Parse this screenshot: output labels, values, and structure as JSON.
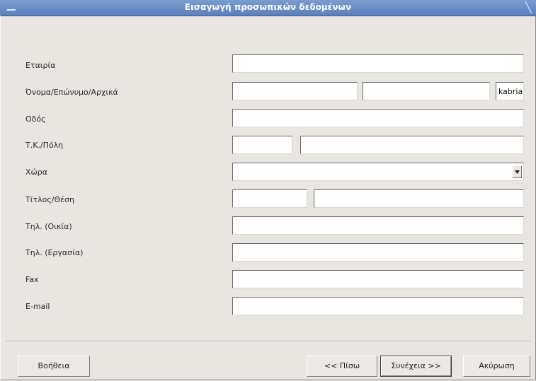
{
  "window": {
    "title": "Εισαγωγή προσωπικών δεδομένων"
  },
  "form": {
    "company_label": "Εταιρία",
    "name_label": "Όνομα/Επώνυμο/Αρχικά",
    "street_label": "Οδός",
    "zip_city_label": "Τ.Κ./Πόλη",
    "country_label": "Χώρα",
    "title_position_label": "Τίτλος/Θέση",
    "phone_home_label": "Τηλ. (Οικία)",
    "phone_work_label": "Τηλ. (Εργασία)",
    "fax_label": "Fax",
    "email_label": "E-mail",
    "company_value": "",
    "first_name_value": "",
    "last_name_value": "",
    "initials_value": "kabria",
    "street_value": "",
    "zip_value": "",
    "city_value": "",
    "country_value": "",
    "title_value": "",
    "position_value": "",
    "phone_home_value": "",
    "phone_work_value": "",
    "fax_value": "",
    "email_value": ""
  },
  "buttons": {
    "help": "Βοήθεια",
    "back": "<< Πίσω",
    "next": "Συνέχεια >>",
    "cancel": "Ακύρωση"
  },
  "icons": {
    "window_menu": "window-menu-icon",
    "close": "close-icon",
    "dropdown": "chevron-down-icon"
  }
}
